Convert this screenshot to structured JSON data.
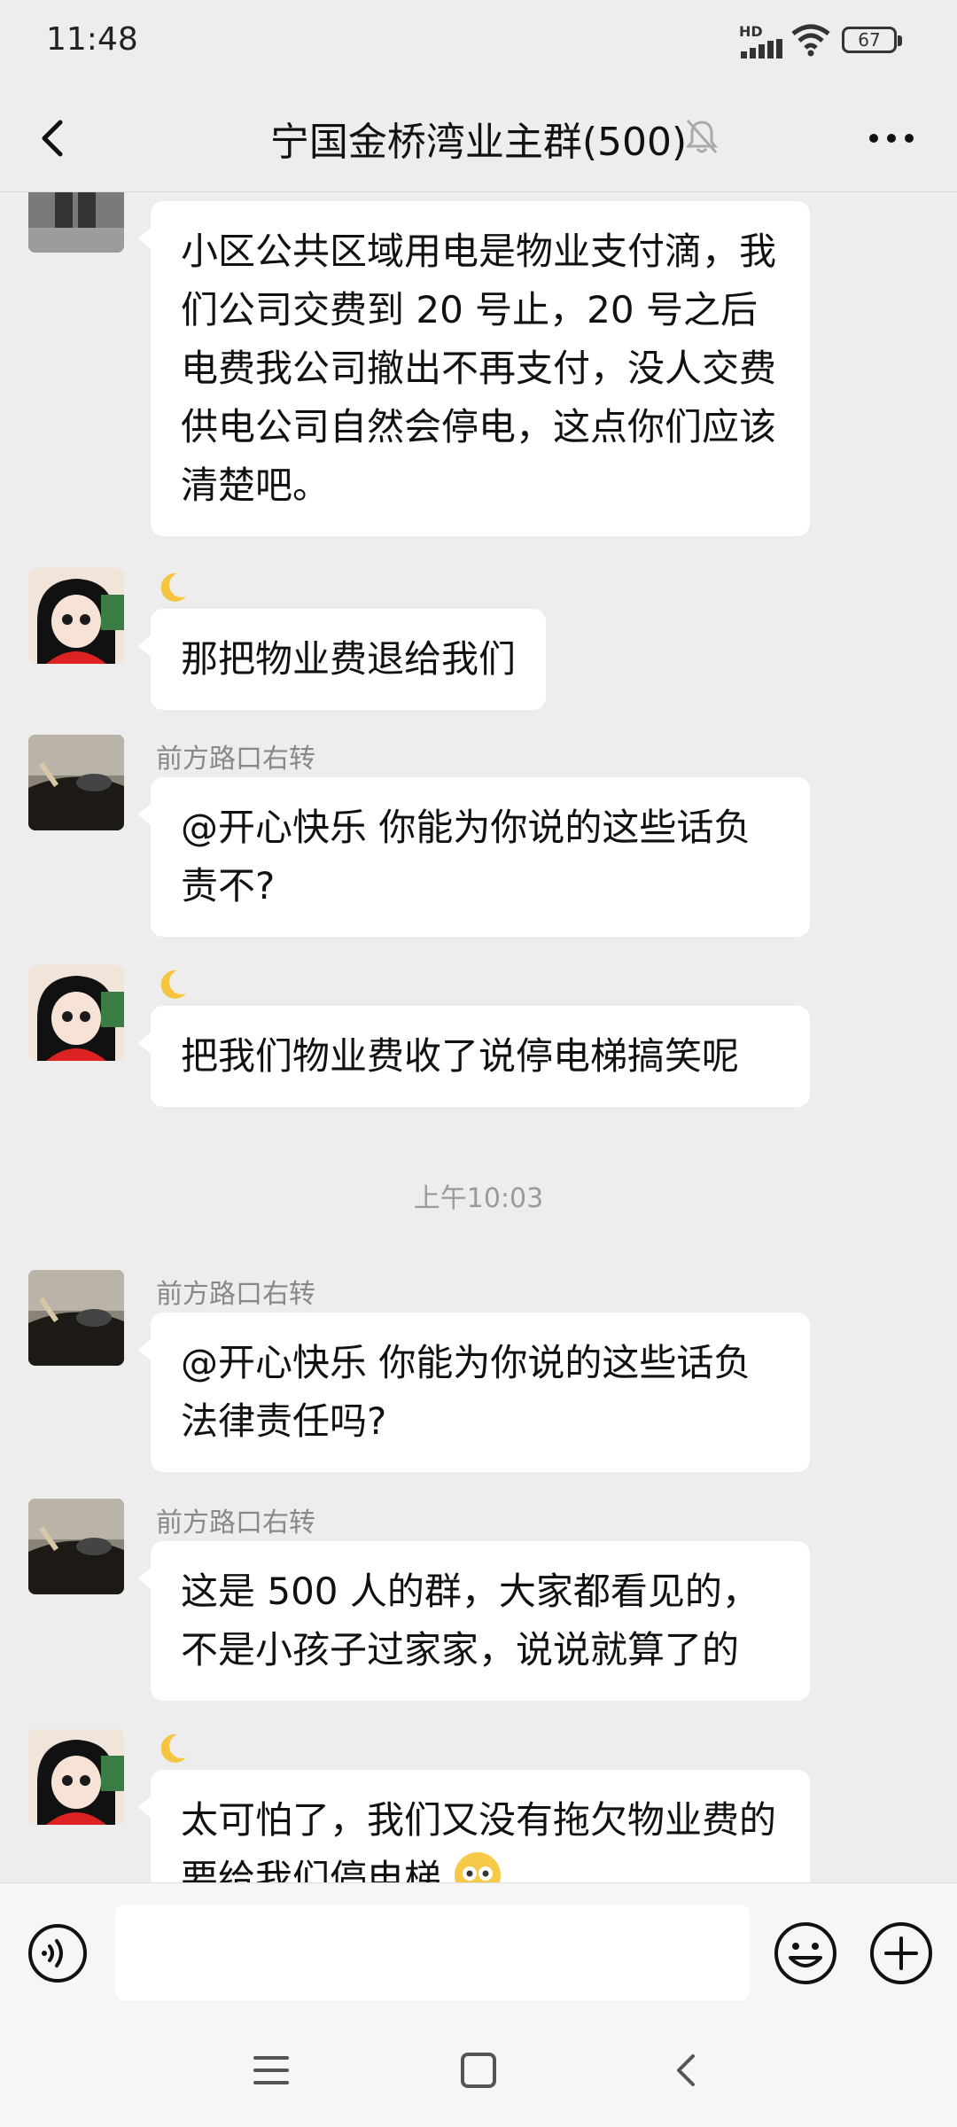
{
  "status_bar": {
    "time": "11:48",
    "network": "HD",
    "battery": "67"
  },
  "header": {
    "title": "宁国金桥湾业主群(500)"
  },
  "messages": [
    {
      "sender": "",
      "text": "小区公共区域用电是物业支付滴，我们公司交费到 20 号止，20 号之后电费我公司撤出不再支付，没人交费供电公司自然会停电，这点你们应该清楚吧。"
    },
    {
      "sender_icon": "crescent-moon",
      "text": "那把物业费退给我们"
    },
    {
      "sender": "前方路口右转",
      "text": "@开心快乐  你能为你说的这些话负责不?"
    },
    {
      "sender_icon": "crescent-moon",
      "text": "把我们物业费收了说停电梯搞笑呢"
    },
    {
      "timestamp": "上午10:03"
    },
    {
      "sender": "前方路口右转",
      "text": "@开心快乐  你能为你说的这些话负法律责任吗?"
    },
    {
      "sender": "前方路口右转",
      "text": "这是 500 人的群，大家都看见的，不是小孩子过家家，说说就算了的"
    },
    {
      "sender_icon": "crescent-moon",
      "text": "太可怕了，我们又没有拖欠物业费的要给我们停电梯"
    }
  ],
  "input_bar": {
    "placeholder": ""
  },
  "icons": {
    "back": "back-chevron-icon",
    "mute": "muted-bell-icon",
    "more": "more-dots-icon",
    "voice": "voice-icon",
    "emoji": "emoji-icon",
    "plus": "plus-icon"
  }
}
